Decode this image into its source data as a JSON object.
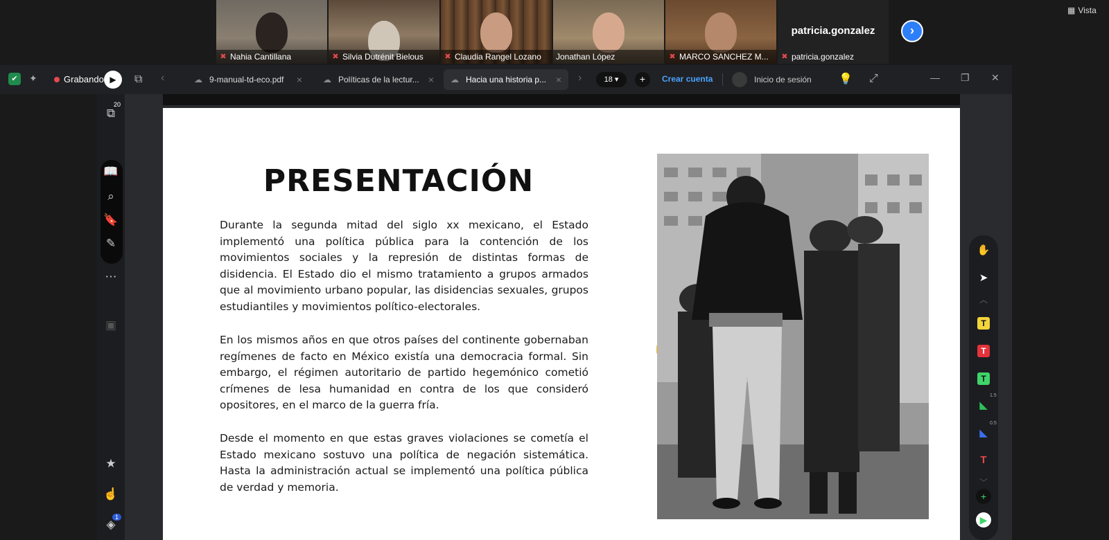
{
  "participants": [
    {
      "name": "Nahia Cantillana",
      "muted": true
    },
    {
      "name": "Silvia Dutrénit Bielous",
      "muted": true
    },
    {
      "name": "Claudia Rangel Lozano",
      "muted": true
    },
    {
      "name": "Jonathan López",
      "muted": false
    },
    {
      "name": "MARCO SANCHEZ M...",
      "muted": true
    },
    {
      "name": "patricia.gonzalez",
      "muted": true
    }
  ],
  "self_tile": {
    "display_name": "patricia.gonzalez"
  },
  "top_right": {
    "view_label": "Vista"
  },
  "recording": {
    "label": "Grabando"
  },
  "tabs": [
    {
      "title": "9-manual-td-eco.pdf"
    },
    {
      "title": "Políticas de la lectur..."
    },
    {
      "title": "Hacia una historia p..."
    }
  ],
  "toolbar": {
    "page_count": "18",
    "create_account": "Crear cuenta",
    "login": "Inicio de sesión"
  },
  "sidebar": {
    "pages_badge": "20",
    "notifications_badge": "1"
  },
  "document": {
    "heading": "PRESENTACIÓN",
    "paragraphs": [
      "Durante la segunda mitad del siglo xx mexicano, el Estado implementó una política pública para la contención de los movimientos sociales y la represión de distintas formas de disidencia. El Estado dio el mismo tratamiento a grupos armados que al movimiento urbano popular, las disidencias sexuales, grupos estudiantiles y movimientos político-electorales.",
      "En los mismos años en que otros países del continente gobernaban regímenes de facto en México existía una democracia formal. Sin embargo, el régimen autoritario de partido hegemónico cometió crímenes de lesa humanidad en contra de los que consideró opositores, en el marco de la guerra fría.",
      "Desde el momento en que estas graves violaciones se cometía el Estado mexicano sostuvo una política de negación sistemática. Hasta la administración actual se implementó una política pública de verdad y memoria."
    ]
  },
  "palette": {
    "size_a": "1.5",
    "size_b": "0.5"
  },
  "colors": {
    "accent_blue": "#2d7ff9",
    "link_blue": "#4aa3ff",
    "rec_red": "#e5484d",
    "speaker_outline": "#c6e05a"
  }
}
